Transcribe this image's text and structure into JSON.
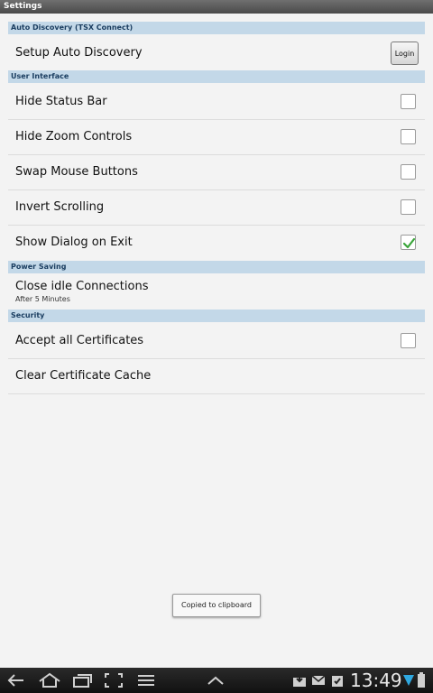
{
  "app": {
    "title": "Settings"
  },
  "sections": {
    "auto_discovery": "Auto Discovery (TSX Connect)",
    "user_interface": "User Interface",
    "power_saving": "Power Saving",
    "security": "Security"
  },
  "settings": {
    "setup_auto_discovery": {
      "label": "Setup Auto Discovery",
      "button": "Login"
    },
    "hide_status_bar": {
      "label": "Hide Status Bar",
      "checked": false
    },
    "hide_zoom_controls": {
      "label": "Hide Zoom Controls",
      "checked": false
    },
    "swap_mouse_buttons": {
      "label": "Swap Mouse Buttons",
      "checked": false
    },
    "invert_scrolling": {
      "label": "Invert Scrolling",
      "checked": false
    },
    "show_dialog_on_exit": {
      "label": "Show Dialog on Exit",
      "checked": true
    },
    "close_idle_connections": {
      "label": "Close idle Connections",
      "summary": "After 5 Minutes"
    },
    "accept_all_certificates": {
      "label": "Accept all Certificates",
      "checked": false
    },
    "clear_certificate_cache": {
      "label": "Clear Certificate Cache"
    }
  },
  "toast": {
    "text": "Copied to clipboard"
  },
  "status_bar": {
    "time": "13:49"
  },
  "colors": {
    "section_bg": "#c3d8e8",
    "check_green": "#3aa53a",
    "navbar_bg": "#111111"
  },
  "icons": [
    "back-icon",
    "home-icon",
    "recent-apps-icon",
    "screenshot-icon",
    "menu-icon",
    "expand-icon",
    "download-icon",
    "mail-icon",
    "task-icon",
    "wifi-icon",
    "battery-icon"
  ]
}
